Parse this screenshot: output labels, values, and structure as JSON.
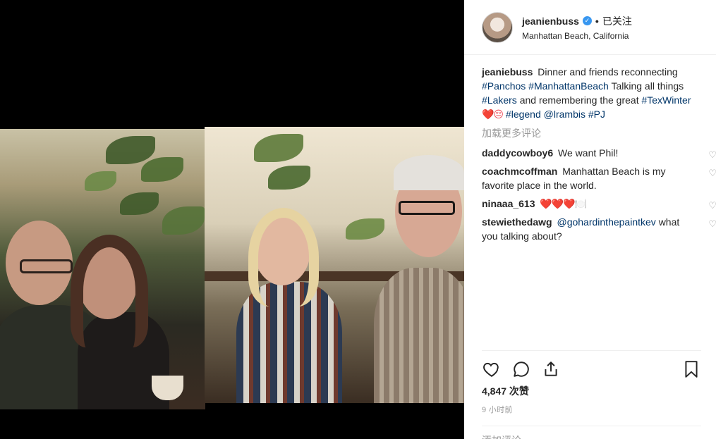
{
  "post": {
    "username": "jeanienbuss",
    "follow_status": "已关注",
    "location": "Manhattan Beach, California",
    "caption": {
      "username": "jeaniebuss",
      "text_1": "Dinner and friends reconnecting",
      "tag_panchos": "#Panchos",
      "tag_manhattan": "#ManhattanBeach",
      "text_2": "Talking all things",
      "tag_lakers": "#Lakers",
      "text_3": "and remembering the great",
      "tag_texwinter": "#TexWinter",
      "emoji": "❤️😔",
      "tag_legend": "#legend",
      "mention_lrambis": "@lrambis",
      "tag_pj": "#PJ"
    },
    "load_more": "加载更多评论",
    "likes": "4,847 次赞",
    "time": "9 小时前",
    "add_comment_placeholder": "添加评论……"
  },
  "comments": [
    {
      "user": "daddycowboy6",
      "text": "We want Phil!"
    },
    {
      "user": "coachmcoffman",
      "text": "Manhattan Beach is my favorite place in the world."
    },
    {
      "user": "ninaaa_613",
      "text": "❤️❤️❤️🍽️"
    },
    {
      "user": "stewiethedawg",
      "text_mention": "@gohardinthepaintkev",
      "text": "what you talking about?"
    }
  ],
  "icons": [
    "verified-badge-icon",
    "heart-icon",
    "comment-icon",
    "share-icon",
    "bookmark-icon"
  ],
  "colors": {
    "link": "#003569",
    "verified": "#3897f0",
    "muted": "#999999",
    "text": "#262626"
  }
}
